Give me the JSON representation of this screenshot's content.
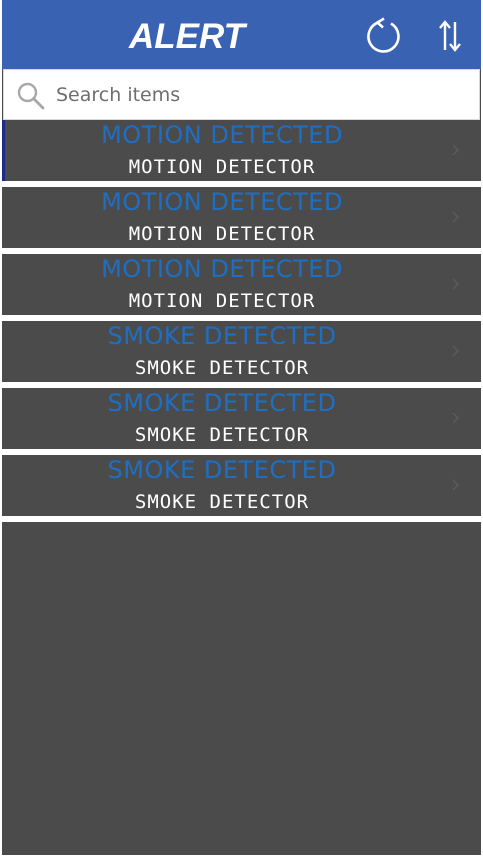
{
  "header": {
    "title": "ALERT",
    "refresh_icon": "refresh-icon",
    "sort_icon": "sort-icon"
  },
  "search": {
    "placeholder": "Search items",
    "value": ""
  },
  "items": [
    {
      "title": "MOTION DETECTED",
      "subtitle": "MOTION DETECTOR"
    },
    {
      "title": "MOTION DETECTED",
      "subtitle": "MOTION DETECTOR"
    },
    {
      "title": "MOTION DETECTED",
      "subtitle": "MOTION DETECTOR"
    },
    {
      "title": "SMOKE DETECTED",
      "subtitle": "SMOKE DETECTOR"
    },
    {
      "title": "SMOKE DETECTED",
      "subtitle": "SMOKE DETECTOR"
    },
    {
      "title": "SMOKE DETECTED",
      "subtitle": "SMOKE DETECTOR"
    }
  ],
  "colors": {
    "header_bg": "#3a62b3",
    "item_title": "#1e6fc4",
    "list_bg": "#4b4b4b"
  }
}
